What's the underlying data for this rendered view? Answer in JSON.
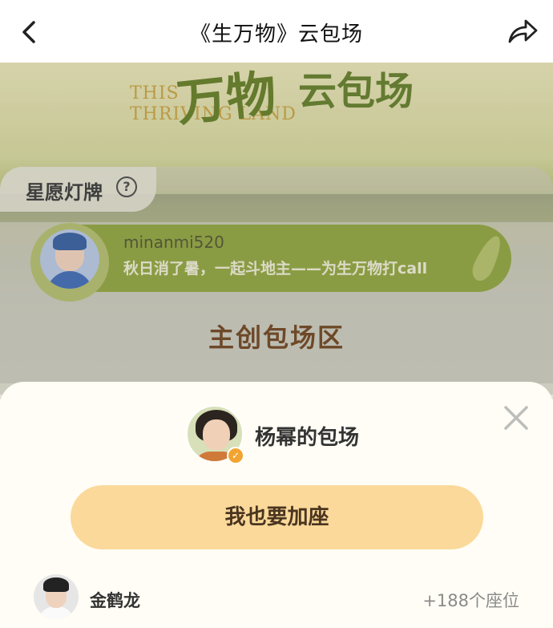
{
  "nav": {
    "title": "《生万物》云包场",
    "back_icon": "chevron-left-icon",
    "share_icon": "share-arrow-icon"
  },
  "banner": {
    "logo_en_line1": "THIS",
    "logo_en_line2": "THRIVING LAND",
    "logo_cn": "万物",
    "logo_sub": "云包场"
  },
  "wish": {
    "title": "星愿灯牌",
    "help_icon": "question-circle-icon",
    "username": "minanmi520",
    "message": "秋日消了暑，一起斗地主——为生万物打call"
  },
  "section": {
    "title": "主创包场区"
  },
  "sheet": {
    "host_name": "杨幂的包场",
    "verified_icon": "verified-badge-icon",
    "close_icon": "close-x-icon",
    "join_label": "我也要加座",
    "rows": [
      {
        "name": "金鹤龙",
        "seats": "+188个座位"
      }
    ]
  },
  "colors": {
    "accent_button": "#fbd99a",
    "pill_green": "#8ea437",
    "section_title": "#6b3f18",
    "verified": "#f2a431"
  }
}
